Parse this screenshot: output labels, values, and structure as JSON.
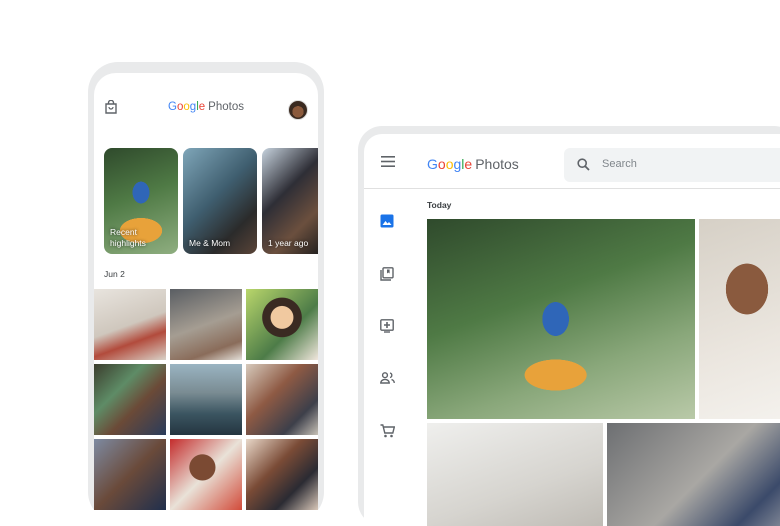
{
  "phone": {
    "logo_google": [
      "G",
      "o",
      "o",
      "g",
      "l",
      "e"
    ],
    "logo_photos": "Photos",
    "memories": [
      {
        "label": "Recent\nhighlights"
      },
      {
        "label": "Me & Mom"
      },
      {
        "label": "1 year ago"
      }
    ],
    "date_section": "Jun 2"
  },
  "tablet": {
    "logo_google": [
      "G",
      "o",
      "o",
      "g",
      "l",
      "e"
    ],
    "logo_photos": "Photos",
    "search": {
      "placeholder": "Search"
    },
    "section_label": "Today"
  },
  "colors": {
    "google_blue": "#4285F4",
    "google_red": "#EA4335",
    "google_yellow": "#FBBC05",
    "google_green": "#34A853",
    "accent_blue": "#1a73e8",
    "nav_icon": "#5f6368"
  }
}
